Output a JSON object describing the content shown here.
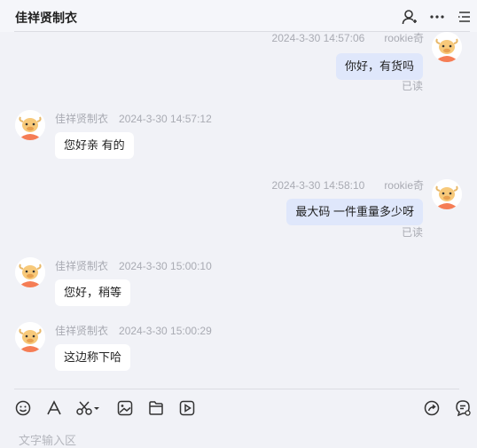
{
  "header": {
    "title": "佳祥贤制衣"
  },
  "messages": [
    {
      "side": "out",
      "name": "rookie奇",
      "time": "2024-3-30 14:57:06",
      "text": "你好，有货吗",
      "status": "已读"
    },
    {
      "side": "in",
      "name": "佳祥贤制衣",
      "time": "2024-3-30 14:57:12",
      "text": "您好亲 有的"
    },
    {
      "side": "out",
      "name": "rookie奇",
      "time": "2024-3-30 14:58:10",
      "text": "最大码  一件重量多少呀",
      "status": "已读"
    },
    {
      "side": "in",
      "name": "佳祥贤制衣",
      "time": "2024-3-30 15:00:10",
      "text": "您好，稍等"
    },
    {
      "side": "in",
      "name": "佳祥贤制衣",
      "time": "2024-3-30 15:00:29",
      "text": "这边称下哈"
    }
  ],
  "input": {
    "placeholder": "文字输入区"
  },
  "colors": {
    "out_bubble": "#dfe7fb",
    "in_bubble": "#ffffff",
    "background": "#f1f2f7"
  },
  "icons": {
    "header": [
      "user-add-icon",
      "more-icon",
      "list-icon"
    ],
    "toolbar": [
      "emoji-icon",
      "font-icon",
      "scissors-icon",
      "image-icon",
      "file-icon",
      "video-icon",
      "share-icon",
      "chat-settings-icon"
    ]
  }
}
